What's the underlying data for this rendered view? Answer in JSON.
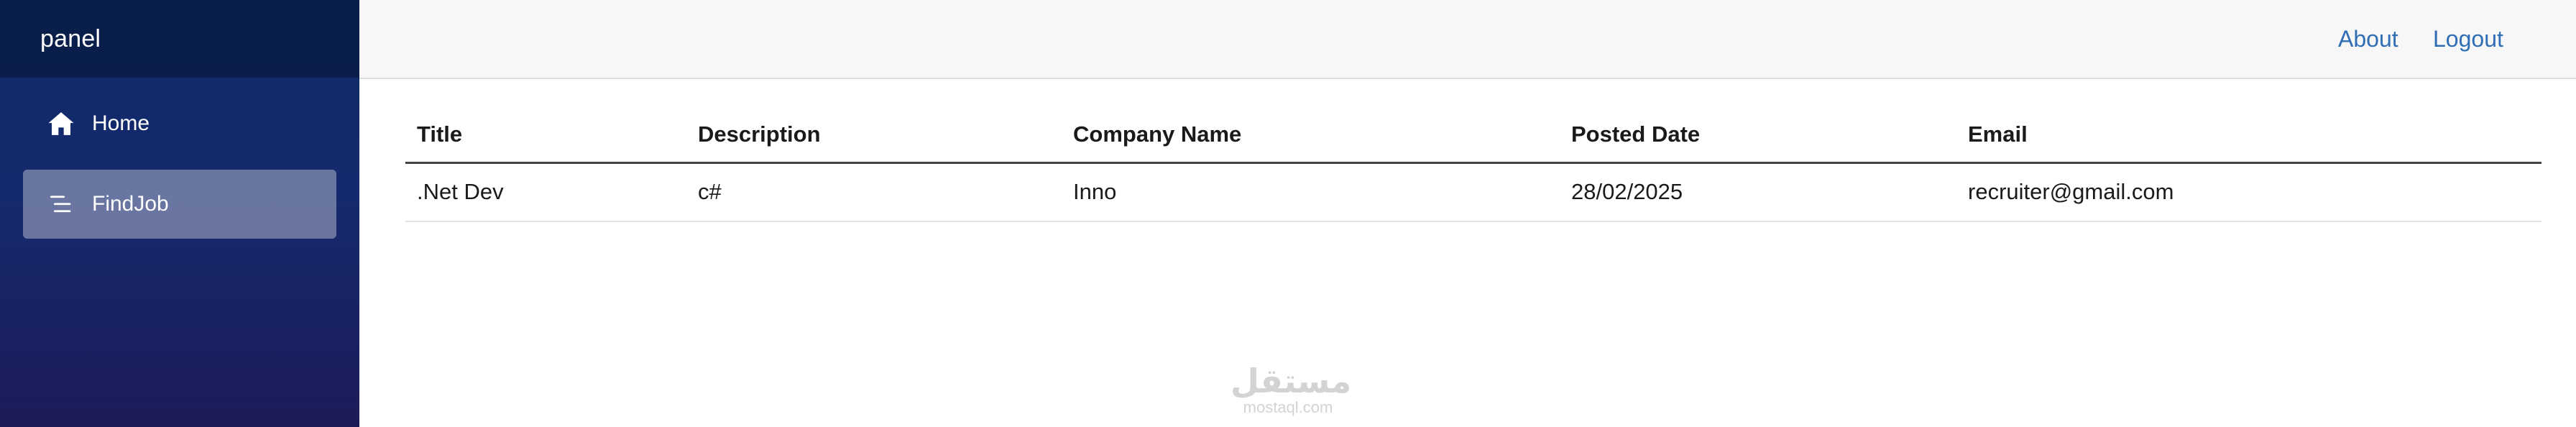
{
  "sidebar": {
    "brand": "panel",
    "items": [
      {
        "label": "Home",
        "icon": "home-icon",
        "active": false
      },
      {
        "label": "FindJob",
        "icon": "list-icon",
        "active": true
      }
    ]
  },
  "header": {
    "links": [
      {
        "label": "About"
      },
      {
        "label": "Logout"
      }
    ]
  },
  "table": {
    "columns": [
      "Title",
      "Description",
      "Company Name",
      "Posted Date",
      "Email"
    ],
    "rows": [
      [
        ".Net Dev",
        "c#",
        "Inno",
        "28/02/2025",
        "recruiter@gmail.com"
      ]
    ]
  },
  "watermark": {
    "arabic": "مستقل",
    "latin": "mostaql.com"
  },
  "colors": {
    "sidebar_top": "#0d2a66",
    "sidebar_bottom": "#1c1b58",
    "link": "#2f6db5",
    "topbar_bg": "#f7f7f7"
  }
}
